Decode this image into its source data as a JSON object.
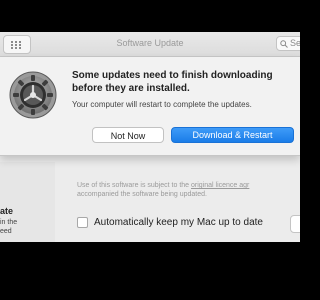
{
  "window": {
    "title": "Software Update",
    "search_placeholder": "Se"
  },
  "alert": {
    "heading": "Some updates need to finish downloading before they are installed.",
    "body": "Your computer will restart to complete the updates.",
    "secondary_button": "Not Now",
    "primary_button": "Download & Restart"
  },
  "pane": {
    "side_title": "ate",
    "side_text": "in the\need",
    "licence_text_before": "Use of this software is subject to the ",
    "licence_link": "original licence agr",
    "licence_text_after": "accompanied the software being updated.",
    "auto_update_label": "Automatically keep my Mac up to date"
  },
  "colors": {
    "accent": "#1a7de8",
    "sheet_bg": "#f2f2f2",
    "window_bg": "#ececec"
  }
}
